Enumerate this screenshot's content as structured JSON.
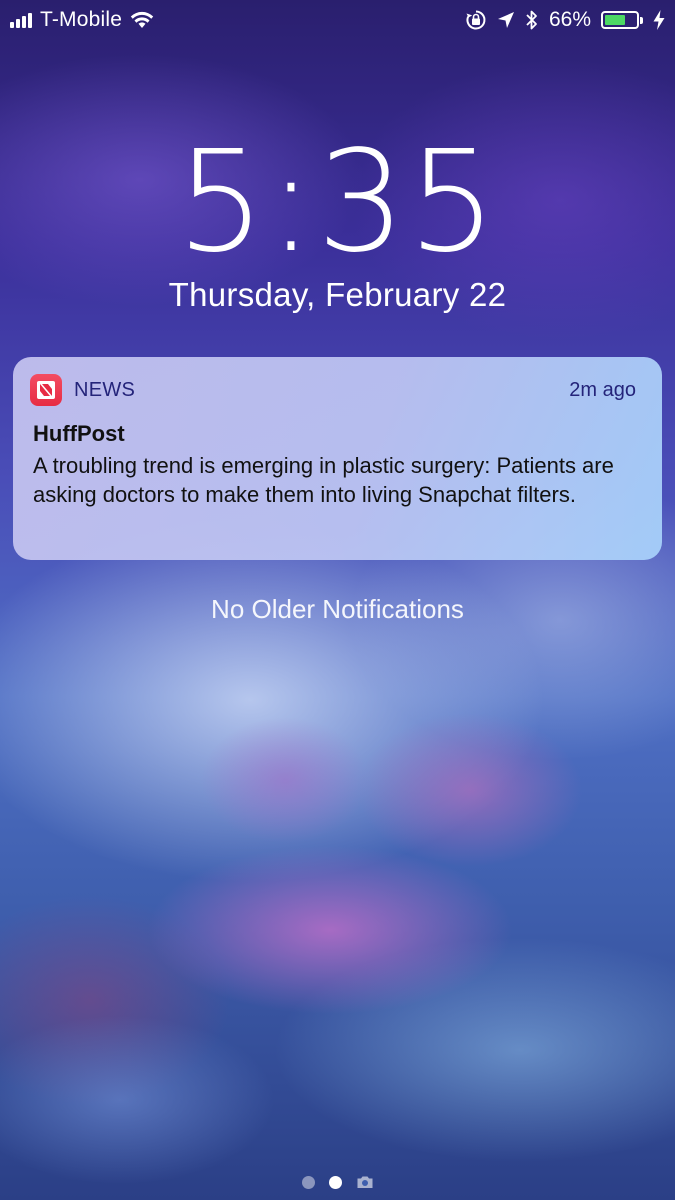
{
  "status_bar": {
    "carrier": "T-Mobile",
    "signal_bars": 4,
    "icons": [
      "signal-icon",
      "wifi-icon",
      "orientation-lock-icon",
      "location-icon",
      "bluetooth-icon",
      "battery-icon",
      "charging-icon"
    ],
    "battery_percent_label": "66%",
    "battery_level": 0.66,
    "battery_color": "#4cd964"
  },
  "lock_screen": {
    "time": "5:35",
    "date": "Thursday, February 22"
  },
  "notification": {
    "app_icon": "news-app-icon",
    "app_icon_color": "#e72c44",
    "app_name": "NEWS",
    "time_ago": "2m ago",
    "title": "HuffPost",
    "body": "A troubling trend is emerging in plastic surgery: Patients are asking doctors to make them into living Snapchat filters."
  },
  "no_older_label": "No Older Notifications",
  "page_indicator": {
    "items": [
      "dot",
      "dot-active",
      "camera-icon"
    ]
  }
}
